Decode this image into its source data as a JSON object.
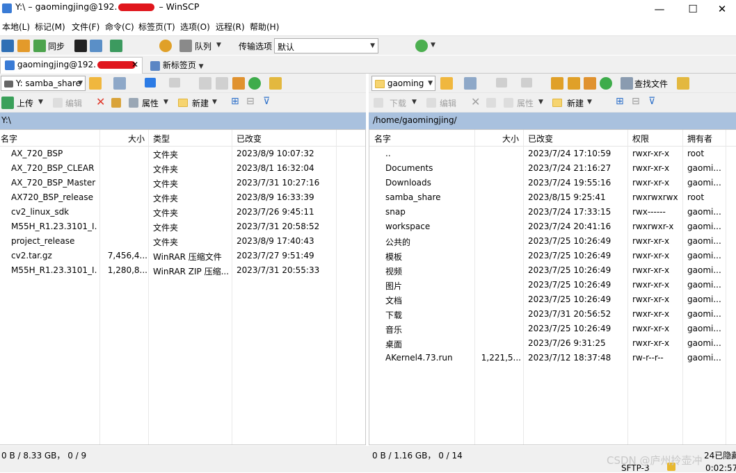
{
  "title": {
    "prefix": "Y:\\ – gaomingjing@192.",
    "suffix": " – WinSCP"
  },
  "window_controls": {
    "minimize": "—",
    "maximize": "☐",
    "close": "✕"
  },
  "menu": [
    "本地(L)",
    "标记(M)",
    "文件(F)",
    "命令(C)",
    "标签页(T)",
    "选项(O)",
    "远程(R)",
    "帮助(H)"
  ],
  "toolbar": {
    "sync_label": "同步",
    "queue_label": "队列",
    "transfer_label": "传输选项",
    "transfer_value": "默认"
  },
  "tabs": {
    "session": "gaomingjing@192.",
    "new_tab": "新标签页"
  },
  "local": {
    "drive": "Y: samba_share",
    "actions": {
      "upload": "上传",
      "edit": "编辑",
      "properties": "属性",
      "new": "新建"
    },
    "path": "Y:\\",
    "columns": {
      "name": "名字",
      "size": "大小",
      "type": "类型",
      "changed": "已改变"
    },
    "files": [
      {
        "name": "AX_720_BSP",
        "size": "",
        "type": "文件夹",
        "changed": "2023/8/9 10:07:32",
        "icon": "folder"
      },
      {
        "name": "AX_720_BSP_CLEAR",
        "size": "",
        "type": "文件夹",
        "changed": "2023/8/1 16:32:04",
        "icon": "folder"
      },
      {
        "name": "AX_720_BSP_Master",
        "size": "",
        "type": "文件夹",
        "changed": "2023/7/31 10:27:16",
        "icon": "folder"
      },
      {
        "name": "AX720_BSP_release",
        "size": "",
        "type": "文件夹",
        "changed": "2023/8/9 16:33:39",
        "icon": "folder"
      },
      {
        "name": "cv2_linux_sdk",
        "size": "",
        "type": "文件夹",
        "changed": "2023/7/26 9:45:11",
        "icon": "folder"
      },
      {
        "name": "M55H_R1.23.3101_I...",
        "size": "",
        "type": "文件夹",
        "changed": "2023/7/31 20:58:52",
        "icon": "folder"
      },
      {
        "name": "project_release",
        "size": "",
        "type": "文件夹",
        "changed": "2023/8/9 17:40:43",
        "icon": "folder"
      },
      {
        "name": "cv2.tar.gz",
        "size": "7,456,4...",
        "type": "WinRAR 压缩文件",
        "changed": "2023/7/27 9:51:49",
        "icon": "rar"
      },
      {
        "name": "M55H_R1.23.3101_I...",
        "size": "1,280,8...",
        "type": "WinRAR ZIP 压缩...",
        "changed": "2023/7/31 20:55:33",
        "icon": "rar"
      }
    ],
    "status": "0 B / 8.33 GB，  0 / 9"
  },
  "remote": {
    "dir": "gaoming",
    "find_label": "查找文件",
    "actions": {
      "download": "下载",
      "edit": "编辑",
      "properties": "属性",
      "new": "新建"
    },
    "path": "/home/gaomingjing/",
    "columns": {
      "name": "名字",
      "size": "大小",
      "changed": "已改变",
      "rights": "权限",
      "owner": "拥有者"
    },
    "files": [
      {
        "name": "..",
        "size": "",
        "changed": "2023/7/24 17:10:59",
        "rights": "rwxr-xr-x",
        "owner": "root",
        "icon": "parent"
      },
      {
        "name": "Documents",
        "size": "",
        "changed": "2023/7/24 21:16:27",
        "rights": "rwxr-xr-x",
        "owner": "gaomi...",
        "icon": "folder"
      },
      {
        "name": "Downloads",
        "size": "",
        "changed": "2023/7/24 19:55:16",
        "rights": "rwxr-xr-x",
        "owner": "gaomi...",
        "icon": "folder"
      },
      {
        "name": "samba_share",
        "size": "",
        "changed": "2023/8/15 9:25:41",
        "rights": "rwxrwxrwx",
        "owner": "root",
        "icon": "folder"
      },
      {
        "name": "snap",
        "size": "",
        "changed": "2023/7/24 17:33:15",
        "rights": "rwx------",
        "owner": "gaomi...",
        "icon": "folder"
      },
      {
        "name": "workspace",
        "size": "",
        "changed": "2023/7/24 20:41:16",
        "rights": "rwxrwxr-x",
        "owner": "gaomi...",
        "icon": "folder"
      },
      {
        "name": "公共的",
        "size": "",
        "changed": "2023/7/25 10:26:49",
        "rights": "rwxr-xr-x",
        "owner": "gaomi...",
        "icon": "folder"
      },
      {
        "name": "模板",
        "size": "",
        "changed": "2023/7/25 10:26:49",
        "rights": "rwxr-xr-x",
        "owner": "gaomi...",
        "icon": "folder"
      },
      {
        "name": "视频",
        "size": "",
        "changed": "2023/7/25 10:26:49",
        "rights": "rwxr-xr-x",
        "owner": "gaomi...",
        "icon": "folder"
      },
      {
        "name": "图片",
        "size": "",
        "changed": "2023/7/25 10:26:49",
        "rights": "rwxr-xr-x",
        "owner": "gaomi...",
        "icon": "folder"
      },
      {
        "name": "文档",
        "size": "",
        "changed": "2023/7/25 10:26:49",
        "rights": "rwxr-xr-x",
        "owner": "gaomi...",
        "icon": "folder"
      },
      {
        "name": "下载",
        "size": "",
        "changed": "2023/7/31 20:56:52",
        "rights": "rwxr-xr-x",
        "owner": "gaomi...",
        "icon": "folder"
      },
      {
        "name": "音乐",
        "size": "",
        "changed": "2023/7/25 10:26:49",
        "rights": "rwxr-xr-x",
        "owner": "gaomi...",
        "icon": "folder"
      },
      {
        "name": "桌面",
        "size": "",
        "changed": "2023/7/26 9:31:25",
        "rights": "rwxr-xr-x",
        "owner": "gaomi...",
        "icon": "folder"
      },
      {
        "name": "AKernel4.73.run",
        "size": "1,221,5...",
        "changed": "2023/7/12 18:37:48",
        "rights": "rw-r--r--",
        "owner": "gaomi...",
        "icon": "file"
      }
    ],
    "status": "0 B / 1.16 GB，  0 / 14"
  },
  "statusbar": {
    "hidden": "24已隐藏",
    "protocol": "SFTP-3",
    "elapsed": "0:02:57"
  },
  "watermark": "CSDN @庐州拎壶冲",
  "colors": {
    "path_bar": "#a9c1de",
    "folder": "#f6d470",
    "toolbar": "#f0f0f0"
  }
}
